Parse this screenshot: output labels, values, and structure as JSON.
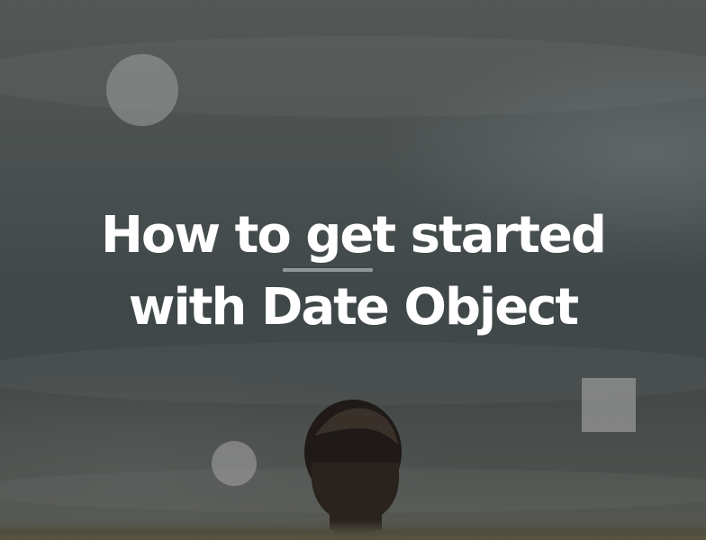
{
  "hero": {
    "title_line_1": "How to get started",
    "title_line_2": "with Date Object"
  },
  "colors": {
    "title_text": "#ffffff",
    "decoration": "#a0a0a0",
    "background_sky": "#464c4c"
  }
}
